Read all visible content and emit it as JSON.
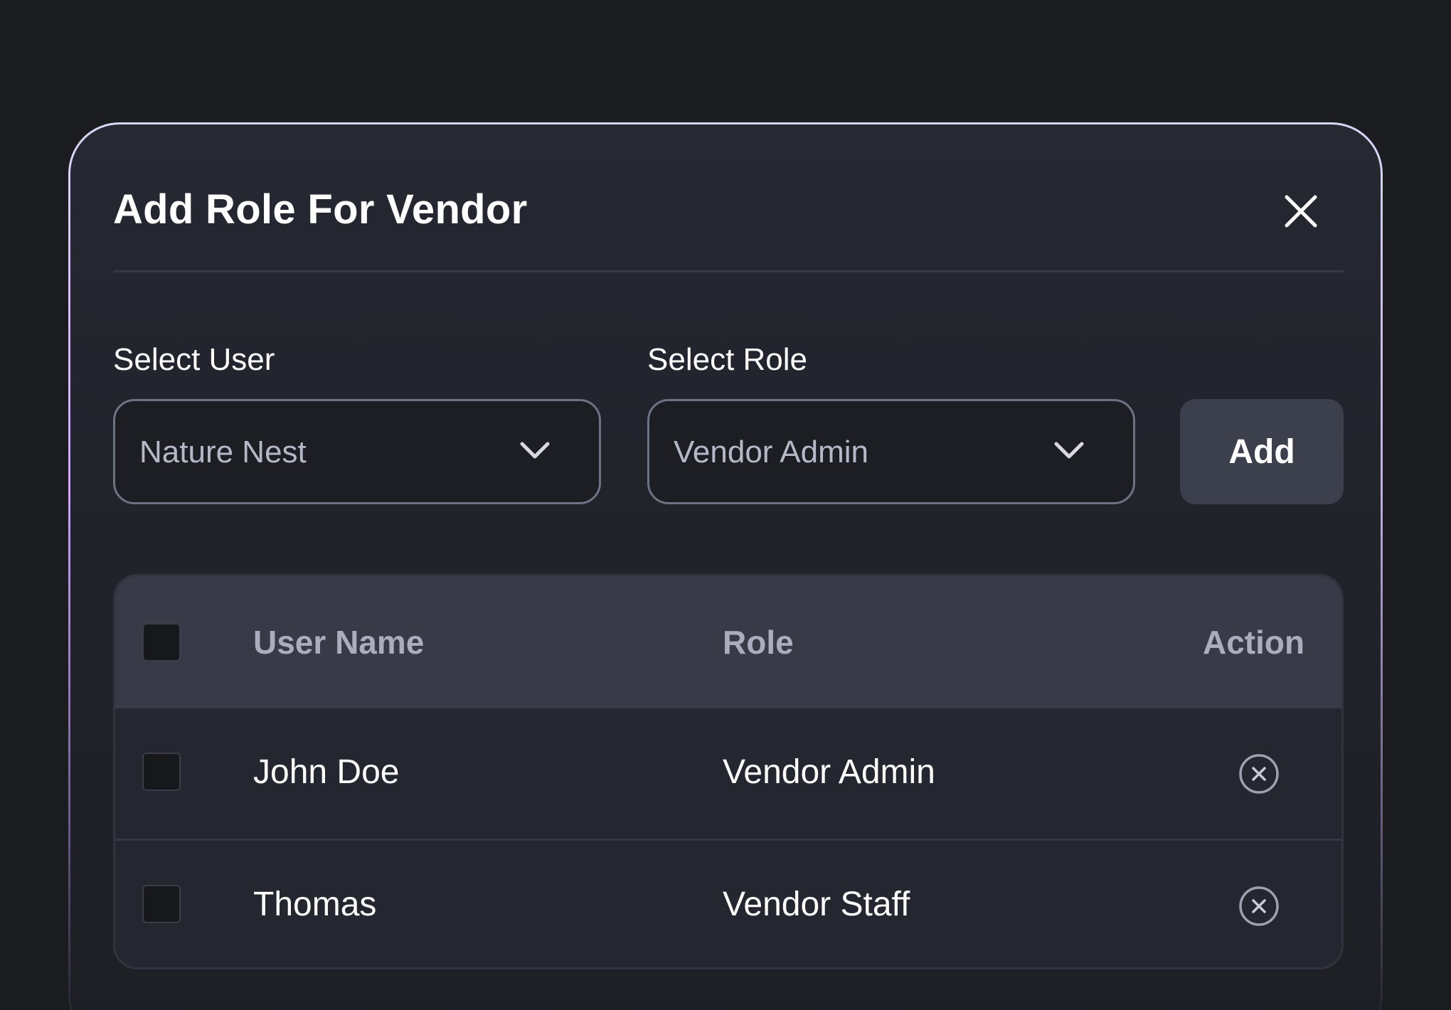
{
  "modal": {
    "title": "Add Role For Vendor"
  },
  "form": {
    "user_label": "Select User",
    "user_value": "Nature Nest",
    "role_label": "Select Role",
    "role_value": "Vendor Admin",
    "add_label": "Add"
  },
  "table": {
    "columns": [
      "User Name",
      "Role",
      "Action"
    ],
    "rows": [
      {
        "user": "John Doe",
        "role": "Vendor Admin"
      },
      {
        "user": "Thomas",
        "role": "Vendor Staff"
      }
    ]
  },
  "icons": {
    "close": "close-icon",
    "chevron": "chevron-down-icon",
    "remove": "remove-circle-icon"
  },
  "colors": {
    "background": "#1b1c20",
    "modal": "#23252d",
    "header_row": "#383a48",
    "button": "#3c404c",
    "border_accent": "#c8a8ef"
  }
}
